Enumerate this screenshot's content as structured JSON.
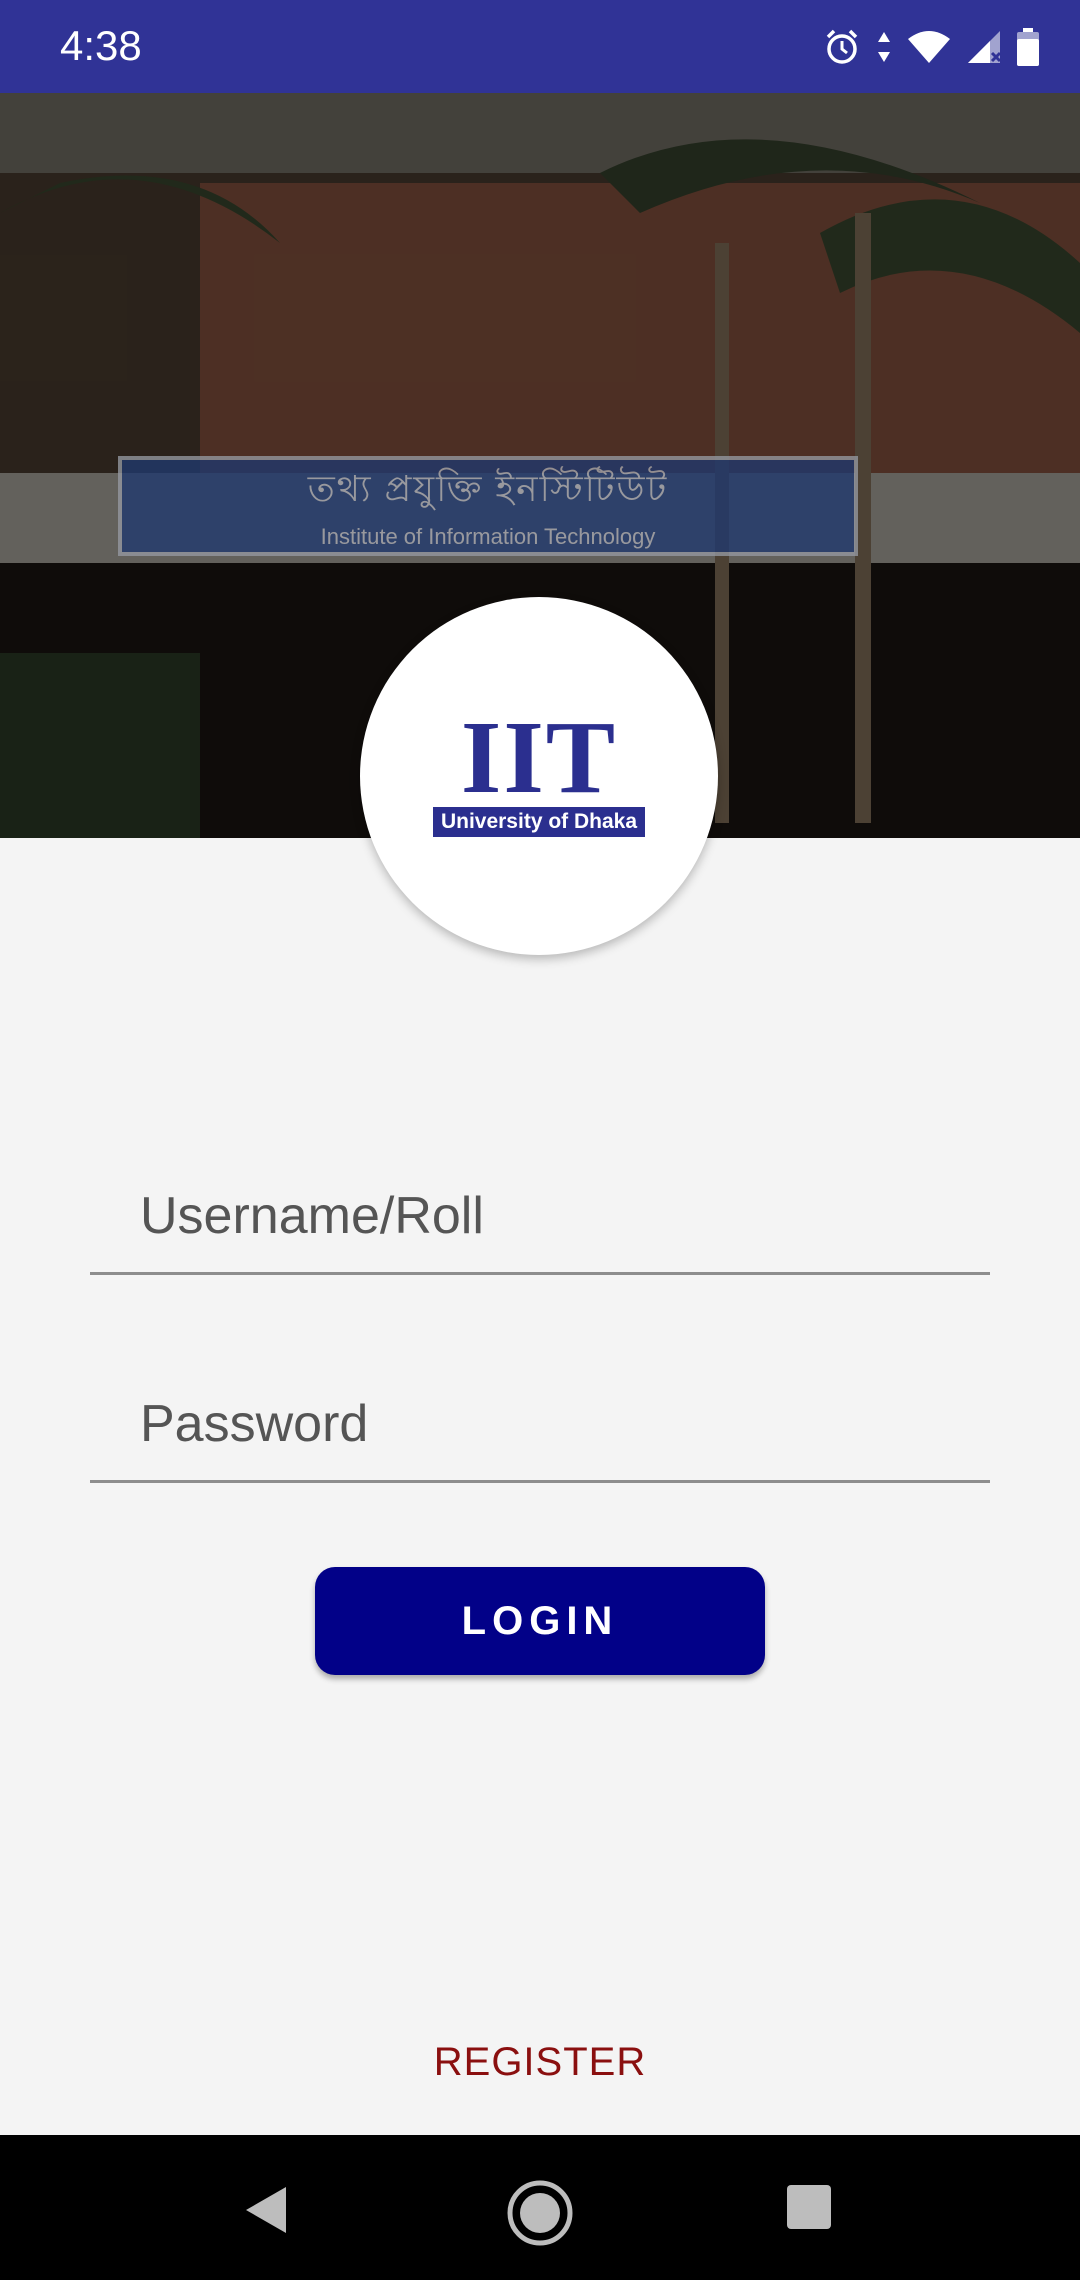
{
  "status_bar": {
    "time": "4:38",
    "icons": [
      "alarm-icon",
      "data-arrows-icon",
      "wifi-icon",
      "signal-icon",
      "battery-icon"
    ]
  },
  "hero": {
    "sign_text_bangla": "তথ্য প্রযুক্তি ইনস্টিটিউট",
    "sign_text_english": "Institute of Information Technology"
  },
  "logo": {
    "mark": "IIT",
    "subtitle": "University of Dhaka"
  },
  "form": {
    "username_placeholder": "Username/Roll",
    "password_placeholder": "Password",
    "login_label": "LOGIN"
  },
  "register_label": "REGISTER",
  "colors": {
    "status_bar": "#303396",
    "login_button": "#020188",
    "register_text": "#8a0f0f",
    "logo_blue": "#2b2f8f"
  },
  "nav_bar": {
    "icons": [
      "back-icon",
      "home-icon",
      "recent-apps-icon"
    ]
  }
}
